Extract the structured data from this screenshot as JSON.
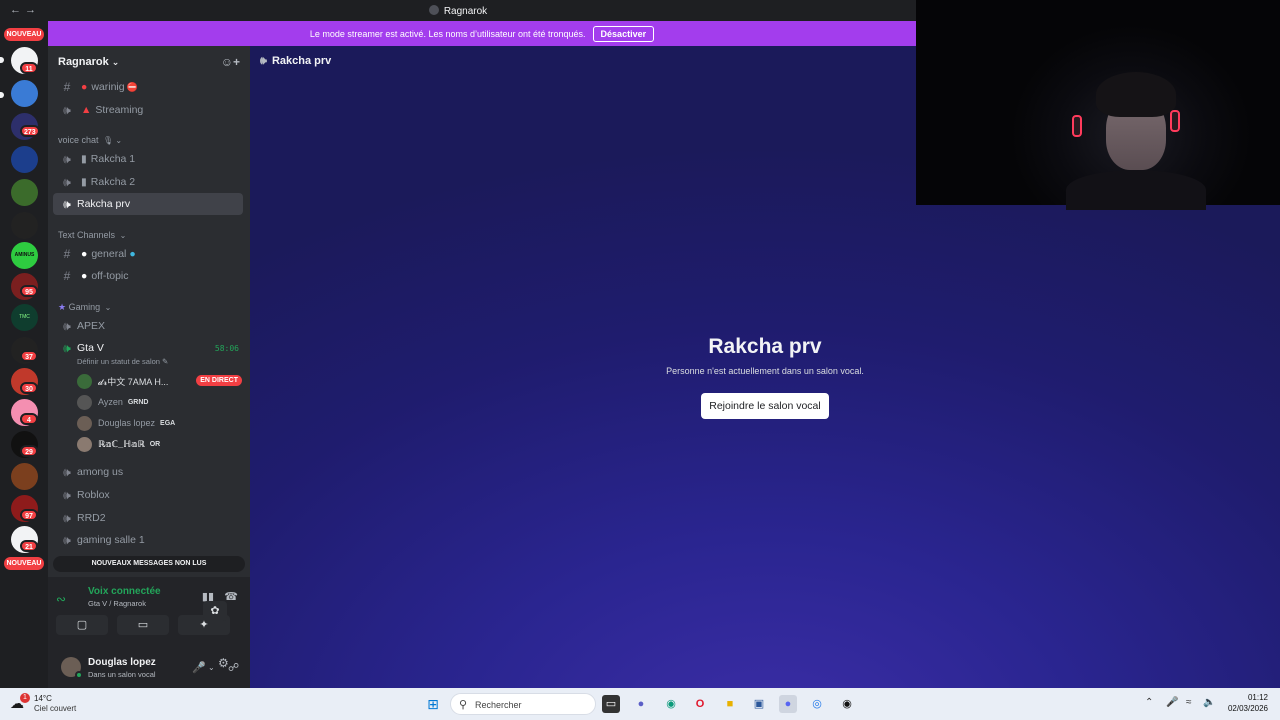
{
  "window": {
    "title": "Ragnarok",
    "back": "←",
    "forward": "→"
  },
  "guild_rail": {
    "top_badge": "NOUVEAU",
    "bottom_badge": "NOUVEAU",
    "badges": [
      {
        "value": "11"
      },
      {
        "value": "273"
      },
      {
        "value": "95"
      },
      {
        "value": "37"
      },
      {
        "value": "30"
      },
      {
        "value": "4"
      },
      {
        "value": "29"
      },
      {
        "value": "97"
      },
      {
        "value": "21"
      }
    ],
    "server_logo_texts": [
      "AMINUS FAMILY",
      "TMC Roleplay",
      "Evil_Null"
    ]
  },
  "banner": {
    "text": "Le mode streamer est activé. Les noms d’utilisateur ont été tronqués.",
    "button": "Désactiver"
  },
  "server": {
    "name": "Ragnarok",
    "chevron": "⌄"
  },
  "channels": {
    "warning": "warinig",
    "warning_emoji": "⛔",
    "streaming": "Streaming",
    "cat_voice": "voice chat",
    "rakcha1": "Rakcha 1",
    "rakcha2": "Rakcha 2",
    "rakcha_prv": "Rakcha prv",
    "cat_text": "Text Channels",
    "general": "general",
    "offtopic": "off-topic",
    "cat_gaming": "Gaming",
    "apex": "APEX",
    "gta": "Gta V",
    "gta_timer": "58:06",
    "gta_status": "Définir un statut de salon",
    "among": "among us",
    "roblox": "Roblox",
    "rrd2": "RRD2",
    "gaming1": "gaming salle 1"
  },
  "voice_users": [
    {
      "name": "𝓭𝓻中文 7AMA H...",
      "tag": "",
      "live": "EN DIRECT"
    },
    {
      "name": "Ayzen",
      "tag": "GRND"
    },
    {
      "name": "Douglas lopez",
      "tag": "EGA"
    },
    {
      "name": "ℝ𝕒ℂ_ℍ𝕒ℝ",
      "tag": "OR"
    }
  ],
  "unread_bar": "NOUVEAUX MESSAGES NON LUS",
  "voice_panel": {
    "status": "Voix connectée",
    "location": "Gta V / Ragnarok"
  },
  "me": {
    "name": "Douglas lopez",
    "status": "Dans un salon vocal"
  },
  "main": {
    "header": "Rakcha prv",
    "title": "Rakcha prv",
    "subtitle": "Personne n'est actuellement dans un salon vocal.",
    "join_button": "Rejoindre le salon vocal"
  },
  "taskbar": {
    "weather_temp": "14°C",
    "weather_desc": "Ciel couvert",
    "weather_badge": "1",
    "search_placeholder": "Rechercher",
    "time": "01:12",
    "date": "02/03/2026"
  },
  "colors": {
    "accent": "#a33ded",
    "green": "#23a55a",
    "red": "#f23f43",
    "blurple": "#2a2590"
  }
}
